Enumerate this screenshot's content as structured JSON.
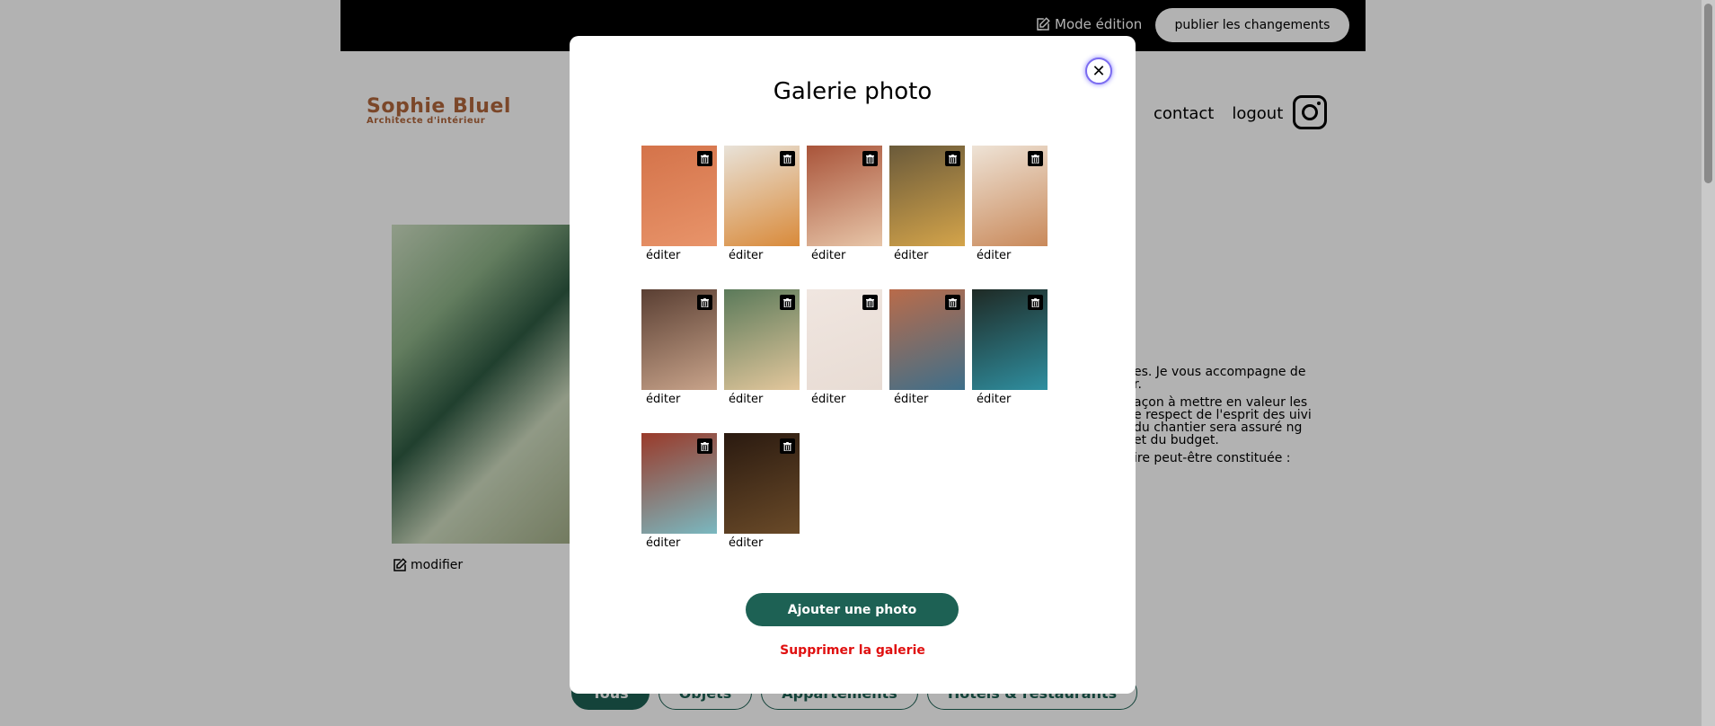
{
  "edit_banner": {
    "mode_label": "Mode édition",
    "publish_label": "publier les changements"
  },
  "header": {
    "logo_title": "Sophie Bluel",
    "logo_subtitle": "Architecte d'intérieur",
    "nav": [
      "contact",
      "logout"
    ],
    "instagram_icon": "instagram-icon"
  },
  "intro": {
    "modify_label": "modifier",
    "text_fragments": [
      "es. Je vous accompagne de r.",
      "açon à mettre en valeur les e respect de l'esprit des uivi du chantier sera assuré ng et du budget.",
      "ire peut-être constituée :"
    ]
  },
  "filters": [
    "Tous",
    "Objets",
    "Appartements",
    "Hôtels & restaurants"
  ],
  "modal": {
    "title": "Galerie photo",
    "close_icon": "close-icon",
    "edit_label": "éditer",
    "add_button": "Ajouter une photo",
    "delete_gallery": "Supprimer la galerie",
    "photos": [
      {
        "edit": "éditer",
        "palette": [
          "#d4734a",
          "#e8946a"
        ]
      },
      {
        "edit": "éditer",
        "palette": [
          "#e8e2d8",
          "#d98a3a"
        ]
      },
      {
        "edit": "éditer",
        "palette": [
          "#a9543a",
          "#e7c5a8"
        ]
      },
      {
        "edit": "éditer",
        "palette": [
          "#6a5a3a",
          "#d4a44a"
        ]
      },
      {
        "edit": "éditer",
        "palette": [
          "#eee3d6",
          "#c9895a"
        ]
      },
      {
        "edit": "éditer",
        "palette": [
          "#5a3f33",
          "#c8a38a"
        ]
      },
      {
        "edit": "éditer",
        "palette": [
          "#5b7a5a",
          "#e3c79c"
        ]
      },
      {
        "edit": "éditer",
        "palette": [
          "#f0e6e0",
          "#e8dcd4"
        ]
      },
      {
        "edit": "éditer",
        "palette": [
          "#b96b4a",
          "#3e6f8a"
        ]
      },
      {
        "edit": "éditer",
        "palette": [
          "#1f2a25",
          "#2f8fa0"
        ]
      },
      {
        "edit": "éditer",
        "palette": [
          "#9a3a2a",
          "#7ab8c0"
        ]
      },
      {
        "edit": "éditer",
        "palette": [
          "#2a1a10",
          "#6a4a28"
        ]
      }
    ]
  },
  "colors": {
    "accent": "#1D6154",
    "brand": "#B1663C",
    "danger": "#e01010"
  }
}
